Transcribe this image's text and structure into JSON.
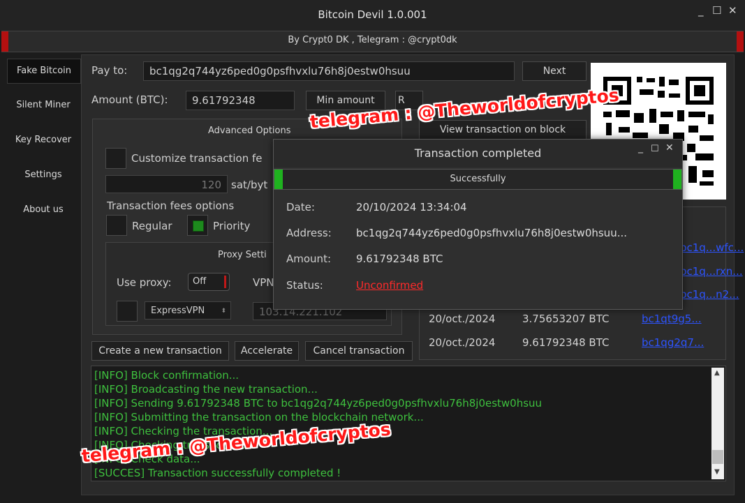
{
  "window": {
    "title": "Bitcoin Devil  1.0.001",
    "subtitle": "By Crypt0 DK , Telegram : @crypt0dk",
    "controls": [
      "_",
      "☐",
      "✕"
    ]
  },
  "sidebar": {
    "items": [
      {
        "label": "Fake Bitcoin",
        "active": true
      },
      {
        "label": "Silent Miner"
      },
      {
        "label": "Key Recover"
      },
      {
        "label": "Settings"
      },
      {
        "label": "About us"
      }
    ]
  },
  "form": {
    "pay_to_label": "Pay to:",
    "pay_to_value": "bc1qg2q744yz6ped0g0psfhvxlu76h8j0estw0hsuu",
    "next_label": "Next",
    "amount_label": "Amount (BTC):",
    "amount_value": "9.61792348",
    "min_amount_label": "Min amount",
    "partial_btn_label": "R",
    "view_tx_label": "View transaction on block",
    "advanced_options_label": "Advanced Options",
    "customize_fee_label": "Customize transaction fe",
    "fee_value": "120",
    "fee_unit": "sat/byt",
    "fee_options_label": "Transaction fees options",
    "regular_label": "Regular",
    "priority_label": "Priority",
    "proxy_settings_label": "Proxy Setti",
    "use_proxy_label": "Use proxy:",
    "proxy_toggle": "Off",
    "vpn_label": "VPN",
    "vpn_select": "ExpressVPN",
    "ip_value": "103.14.221.102"
  },
  "actions": {
    "create": "Create a new transaction",
    "accelerate": "Accelerate",
    "cancel": "Cancel transaction"
  },
  "transactions": [
    {
      "link": "bc1q...wfc..."
    },
    {
      "link": "bc1q...rxn..."
    },
    {
      "link": "bc1q...n2..."
    },
    {
      "date": "20/oct./2024",
      "amount": "3.75653207 BTC",
      "link": "bc1qt9g5..."
    },
    {
      "date": "20/oct./2024",
      "amount": "9.61792348 BTC",
      "link": "bc1qg2q7..."
    }
  ],
  "log": [
    "[INFO]  Block confirmation...",
    "[INFO]  Broadcasting the new transaction...",
    "[INFO]  Sending 9.61792348 BTC to bc1qg2q744yz6ped0g0psfhvxlu76h8j0estw0hsuu",
    "[INFO]  Submitting the transaction on the blockchain network...",
    "[INFO]  Checking the transaction...",
    "[INFO]  Checking transaction...",
    "[INFO]  Check data...",
    "[SUCCES]  Transaction successfully completed !"
  ],
  "dialog": {
    "title": "Transaction completed",
    "bar_label": "Successfully",
    "date_label": "Date:",
    "date_value": "20/10/2024 13:34:04",
    "address_label": "Address:",
    "address_value": "bc1qg2q744yz6ped0g0psfhvxlu76h8j0estw0hsuu...",
    "amount_label": "Amount:",
    "amount_value": "9.61792348 BTC",
    "status_label": "Status:",
    "status_value": "Unconfirmed"
  },
  "watermark": "telegram : @Theworldofcryptos",
  "colors": {
    "accent_red": "#b41010",
    "success_green": "#1fb21f",
    "log_green": "#3ec03e",
    "link_blue": "#2d54ff",
    "status_red": "#ff2a2a"
  }
}
